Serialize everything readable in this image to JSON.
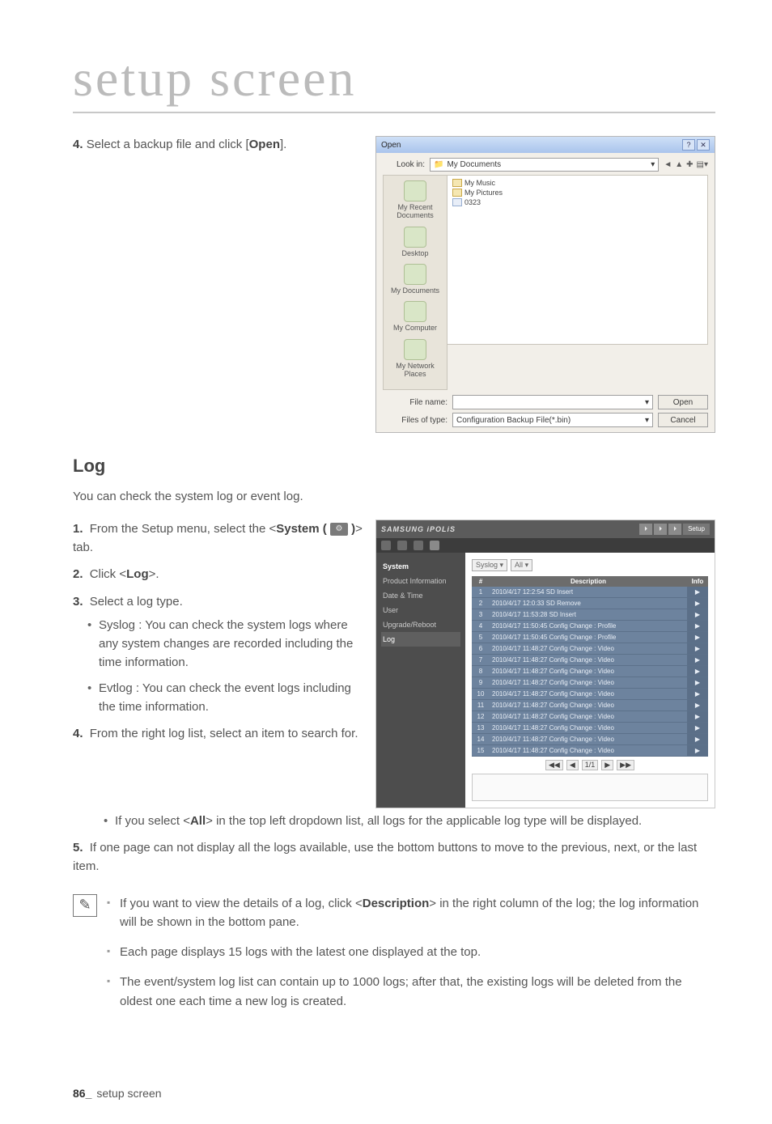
{
  "page": {
    "title": "setup screen",
    "footer_num": "86_",
    "footer_text": "setup screen"
  },
  "step4_top": {
    "num": "4.",
    "text_a": "Select a backup file and click [",
    "text_b": "Open",
    "text_c": "]."
  },
  "log": {
    "heading": "Log",
    "intro": "You can check the system log or event log.",
    "s1": {
      "num": "1.",
      "a": "From the Setup menu, select the <",
      "b": "System (",
      "c": ")",
      "d": "> tab."
    },
    "s2": {
      "num": "2.",
      "a": "Click <",
      "b": "Log",
      "c": ">."
    },
    "s3": {
      "num": "3.",
      "text": "Select a log type.",
      "bul1": "Syslog : You can check the system logs where any system changes are recorded including the time information.",
      "bul2": "Evtlog : You can check the event logs including the time information."
    },
    "s4": {
      "num": "4.",
      "text": "From the right log list, select an item to search for.",
      "bul1a": "If you select <",
      "bul1b": "All",
      "bul1c": "> in the top left dropdown list, all logs for the applicable log type will be displayed."
    },
    "s5": {
      "num": "5.",
      "text": "If one page can not display all the logs available, use the bottom buttons to move to the previous, next, or the last item."
    },
    "notes": {
      "n1a": "If you want to view the details of a log, click <",
      "n1b": "Description",
      "n1c": "> in the right column of the log; the log information will be shown in the bottom pane.",
      "n2": "Each page displays 15 logs with the latest one displayed at the top.",
      "n3": "The event/system log list can contain up to 1000 logs; after that, the existing logs will be deleted from the oldest one each time a new log is created."
    }
  },
  "open_dialog": {
    "title": "Open",
    "lookin_label": "Look in:",
    "lookin_value": "My Documents",
    "toolbar": [
      "back",
      "up",
      "new-folder",
      "views"
    ],
    "places": [
      "My Recent Documents",
      "Desktop",
      "My Documents",
      "My Computer",
      "My Network Places"
    ],
    "files": [
      "My Music",
      "My Pictures",
      "0323"
    ],
    "filename_label": "File name:",
    "filename_value": "",
    "filetype_label": "Files of type:",
    "filetype_value": "Configuration Backup File(*.bin)",
    "open_btn": "Open",
    "cancel_btn": "Cancel"
  },
  "ipolis": {
    "brand_a": "SAMSUNG ",
    "brand_b": "iPOLiS",
    "tabs": [
      "",
      "",
      "",
      "Setup"
    ],
    "side": [
      "System",
      "Product Information",
      "Date & Time",
      "User",
      "Upgrade/Reboot",
      "Log"
    ],
    "dropdown1": "Syslog",
    "dropdown2": "All",
    "th": [
      "#",
      "Description",
      "Info"
    ],
    "rows": [
      {
        "n": "1",
        "d": "2010/4/17 12:2:54 SD Insert",
        "i": "▶"
      },
      {
        "n": "2",
        "d": "2010/4/17 12:0:33 SD Remove",
        "i": "▶"
      },
      {
        "n": "3",
        "d": "2010/4/17 11:53:28 SD Insert",
        "i": "▶"
      },
      {
        "n": "4",
        "d": "2010/4/17 11:50:45 Config Change : Profile",
        "i": "▶"
      },
      {
        "n": "5",
        "d": "2010/4/17 11:50:45 Config Change : Profile",
        "i": "▶"
      },
      {
        "n": "6",
        "d": "2010/4/17 11:48:27 Config Change : Video",
        "i": "▶"
      },
      {
        "n": "7",
        "d": "2010/4/17 11:48:27 Config Change : Video",
        "i": "▶"
      },
      {
        "n": "8",
        "d": "2010/4/17 11:48:27 Config Change : Video",
        "i": "▶"
      },
      {
        "n": "9",
        "d": "2010/4/17 11:48:27 Config Change : Video",
        "i": "▶"
      },
      {
        "n": "10",
        "d": "2010/4/17 11:48:27 Config Change : Video",
        "i": "▶"
      },
      {
        "n": "11",
        "d": "2010/4/17 11:48:27 Config Change : Video",
        "i": "▶"
      },
      {
        "n": "12",
        "d": "2010/4/17 11:48:27 Config Change : Video",
        "i": "▶"
      },
      {
        "n": "13",
        "d": "2010/4/17 11:48:27 Config Change : Video",
        "i": "▶"
      },
      {
        "n": "14",
        "d": "2010/4/17 11:48:27 Config Change : Video",
        "i": "▶"
      },
      {
        "n": "15",
        "d": "2010/4/17 11:48:27 Config Change : Video",
        "i": "▶"
      }
    ],
    "pager": [
      "◀◀",
      "◀",
      "1/1",
      "▶",
      "▶▶"
    ]
  }
}
